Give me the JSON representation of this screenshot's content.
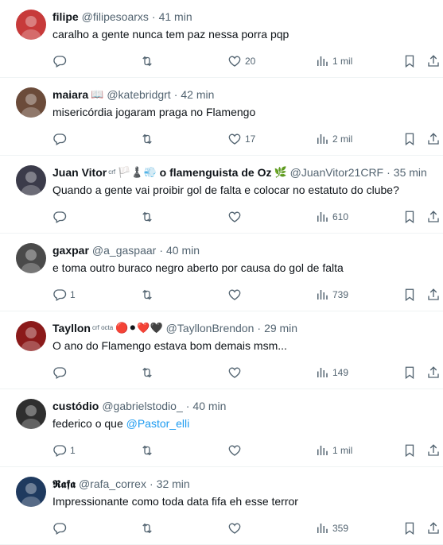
{
  "tweets": [
    {
      "name": "filipe",
      "handle": "@filipesoarxs",
      "time": "41 min",
      "text": "caralho a gente nunca tem paz nessa porra pqp",
      "replies": "",
      "retweets": "",
      "likes": "20",
      "views": "1 mil",
      "avatar_color": "#c73a3a"
    },
    {
      "name": "maiara",
      "name_emoji": "📖",
      "handle": "@katebridgrt",
      "time": "42 min",
      "text": "misericórdia jogaram praga no Flamengo",
      "replies": "",
      "retweets": "",
      "likes": "17",
      "views": "2 mil",
      "avatar_color": "#6b4b3a"
    },
    {
      "name": "Juan Vitor",
      "name_badge": "crf",
      "name_emoji": "🏳️‍♟️💨",
      "name_suffix": "o flamenguista de Oz",
      "name_suffix_emoji": "🌿",
      "handle": "@JuanVitor21CRF",
      "time": "35 min",
      "text": "Quando a gente vai proibir gol de falta e colocar no estatuto do clube?",
      "replies": "",
      "retweets": "",
      "likes": "",
      "views": "610",
      "avatar_color": "#3b3b4a"
    },
    {
      "name": "gaxpar",
      "handle": "@a_gaspaar",
      "time": "40 min",
      "text": "e toma outro buraco negro aberto por causa do gol de falta",
      "replies": "1",
      "retweets": "",
      "likes": "",
      "views": "739",
      "avatar_color": "#4a4a4a"
    },
    {
      "name": "Tayllon",
      "name_badge": "crf octa",
      "name_emoji": "🔴⚫❤️🖤",
      "handle": "@TayllonBrendon",
      "time": "29 min",
      "text": "O ano do Flamengo estava bom demais msm...",
      "replies": "",
      "retweets": "",
      "likes": "",
      "views": "149",
      "avatar_color": "#8b1a1a"
    },
    {
      "name": "custódio",
      "handle": "@gabrielstodio_",
      "time": "40 min",
      "text": "federico o que",
      "mention": "@Pastor_elli",
      "replies": "1",
      "retweets": "",
      "likes": "",
      "views": "1 mil",
      "avatar_color": "#2f2f2f"
    },
    {
      "name": "𝕽𝖆𝖋𝖆",
      "handle": "@rafa_correx",
      "time": "32 min",
      "text": "Impressionante como toda data fifa eh esse terror",
      "replies": "",
      "retweets": "",
      "likes": "",
      "views": "359",
      "avatar_color": "#1f3a5f"
    }
  ],
  "separator": "·",
  "icons": [
    "reply-icon",
    "retweet-icon",
    "like-icon",
    "views-icon",
    "bookmark-icon",
    "share-icon"
  ],
  "colors": {
    "text": "#0f1419",
    "muted": "#536471",
    "link": "#1d9bf0",
    "border": "#eff3f4"
  }
}
